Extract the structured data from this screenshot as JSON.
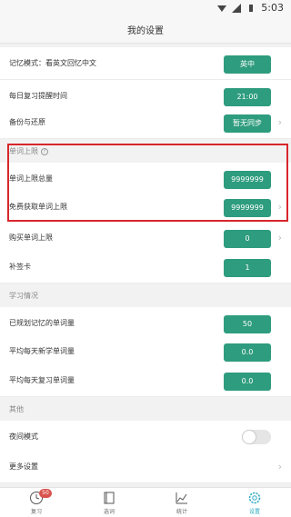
{
  "status_bar": {
    "time": "5:03"
  },
  "header": {
    "title": "我的设置"
  },
  "rows": {
    "memory_mode": {
      "label": "记忆模式：看英文回忆中文",
      "value": "英中"
    },
    "daily_reminder": {
      "label": "每日复习提醒时间",
      "value": "21:00"
    },
    "backup": {
      "label": "备份与还原",
      "value": "暂无同步"
    },
    "word_total_limit": {
      "label": "单词上限总量",
      "value": "9999999"
    },
    "free_word_limit": {
      "label": "免费获取单词上限",
      "value": "9999999"
    },
    "buy_word_limit": {
      "label": "购买单词上限",
      "value": "0"
    },
    "makeup_card": {
      "label": "补签卡",
      "value": "1"
    },
    "planned_words": {
      "label": "已规划记忆的单词量",
      "value": "50"
    },
    "avg_new_words": {
      "label": "平均每天新学单词量",
      "value": "0.0"
    },
    "avg_review_words": {
      "label": "平均每天复习单词量",
      "value": "0.0"
    },
    "night_mode": {
      "label": "夜间模式",
      "enabled": false
    },
    "more_settings": {
      "label": "更多设置"
    }
  },
  "sections": {
    "word_limit": "单词上限",
    "study_status": "学习情况",
    "other": "其他"
  },
  "tabbar": {
    "tabs": [
      {
        "label": "复习",
        "badge": "50",
        "icon": "clock-icon"
      },
      {
        "label": "选词",
        "icon": "book-icon"
      },
      {
        "label": "统计",
        "icon": "chart-icon"
      },
      {
        "label": "设置",
        "icon": "gear-icon",
        "active": true
      }
    ]
  },
  "colors": {
    "accent": "#2e9c7e",
    "highlight_border": "#d8262b",
    "active_tab": "#2aa9c0"
  }
}
